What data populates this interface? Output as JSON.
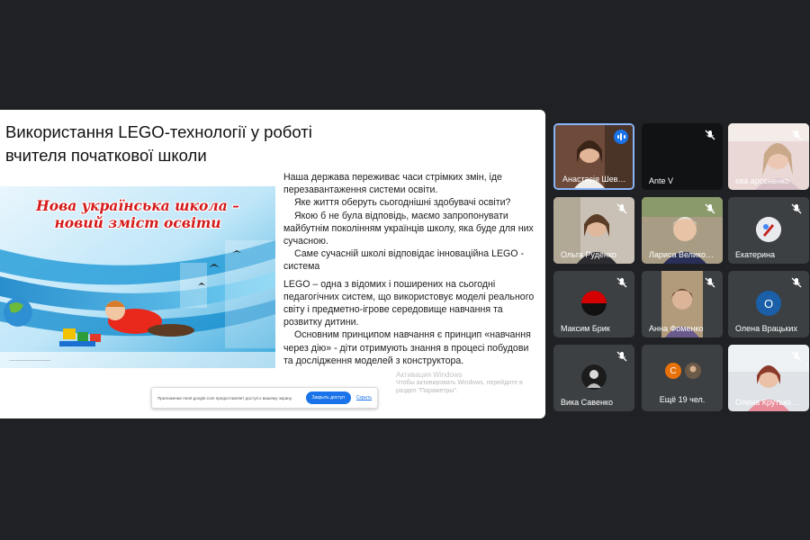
{
  "slide": {
    "title_line1": "Використання LEGO-технології у роботі",
    "title_line2": "вчителя початкової школи",
    "banner_line1": "Нова українська школа –",
    "banner_line2": "новий зміст освіти",
    "paragraphs": [
      "Наша держава переживає часи стрімких змін, іде перезавантаження системи освіти.",
      "Яке життя оберуть сьогоднішні здобувачі освіти?",
      "Якою б не була відповідь, маємо запропонувати майбутнім поколінням українців школу, яка буде для них сучасною.",
      "Саме сучасній школі відповідає інноваційна LEGO - система",
      "LEGO – одна з відомих і поширених на сьогодні педагогічних систем, що використовує моделі реального світу і предметно-ігрове середовище навчання та розвитку дитини.",
      "Основним принципом навчання є принцип «навчання через дію» - діти отримують знання в процесі побудови та дослідження моделей з конструктора."
    ],
    "watermark_line1": "Активация Windows",
    "watermark_line2": "Чтобы активировать Windows, перейдите в раздел \"Параметры\"."
  },
  "share_bar": {
    "text": "Приложение meet.google.com предоставляет доступ к вашему экрану.",
    "button_label": "Закрыть доступ",
    "hide_label": "Скрыть"
  },
  "participants": [
    {
      "name": "Анастасія Шев…",
      "speaking": true
    },
    {
      "name": "Ante V",
      "muted": true
    },
    {
      "name": "єва арсєненко",
      "muted": true
    },
    {
      "name": "Ольга Руденко",
      "muted": true
    },
    {
      "name": "Лариса Велико…",
      "muted": true
    },
    {
      "name": "Екатерина",
      "muted": true
    },
    {
      "name": "Максим Брик",
      "muted": true
    },
    {
      "name": "Анна Фоменко",
      "muted": true
    },
    {
      "name": "Олена Врацьких",
      "muted": true,
      "initial": "О"
    },
    {
      "name": "Вика Савенко",
      "muted": true
    },
    {
      "name": "Ещё 19 чел.",
      "initial": "С"
    },
    {
      "name": "Олена Крутько…",
      "muted": true
    }
  ],
  "colors": {
    "background": "#202124",
    "tile": "#3c4043",
    "accent": "#1a73e8",
    "avatar_orange": "#e8710a",
    "avatar_blue": "#1a5fa8"
  },
  "icons": {
    "muted": "mic-off-icon",
    "speaking": "audio-level-icon"
  }
}
